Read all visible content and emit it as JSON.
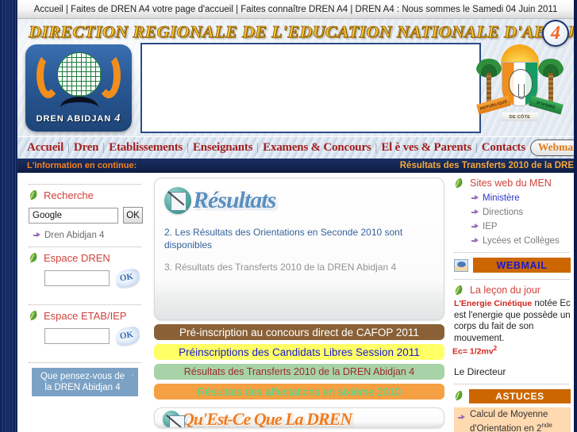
{
  "topbar": {
    "text": "Accueil | Faites de DREN A4 votre page d'accueil | Faites connaître DREN A4 | DREN A4 : Nous sommes le Samedi 04 Juin 2011"
  },
  "header": {
    "title": "DIRECTION REGIONALE DE L'EDUCATION NATIONALE D'ABIDJAN",
    "badge": "4",
    "logo_text": "DREN  ABIDJAN",
    "logo_number": "4",
    "coat_ribbon_left": "REPUBLIQUE",
    "coat_ribbon_right": "D'IVOIRE",
    "coat_ribbon_center": "DE CÔTE"
  },
  "nav": {
    "items": [
      "Accueil",
      "Dren",
      "Etablissements",
      "Enseignants",
      "Examens & Concours",
      "El è ves & Parents",
      "Contacts"
    ],
    "separator": "|",
    "webmail": "Webmail"
  },
  "ticker": {
    "label": "L'information en continue:",
    "text": "Résultats des Transferts 2010 de la DRE"
  },
  "sidebar_left": {
    "search": {
      "title": "Recherche",
      "value": "Google",
      "button": "OK",
      "link": "Dren Abidjan 4"
    },
    "espace_dren": {
      "title": "Espace DREN",
      "value": "",
      "button_label": "OK"
    },
    "espace_etab": {
      "title": "Espace ETAB/IEP",
      "value": "",
      "button_label": "OK"
    },
    "poll": {
      "text": "Que pensez-vous de la DREN Abidjan 4"
    }
  },
  "center": {
    "results_title": "Résultats",
    "results_items": [
      "2. Les Résultats des Orientations en Seconde 2010 sont disponibles",
      "3. Résultats des Transferts 2010 de la DREN Abidjan 4"
    ],
    "bars": [
      {
        "label": "Pré-inscription au concours direct de CAFOP 2011",
        "bg": "#8a6137",
        "fg": "#ffffff"
      },
      {
        "label": "Préinscriptions des Candidats Libres Session 2011",
        "bg": "#ffff66",
        "fg": "#1a1ad0"
      },
      {
        "label": "Résultats des Transferts 2010 de la DREN Abidjan 4",
        "bg": "#a8d3a8",
        "fg": "#9b2a2a"
      },
      {
        "label": "Résultats des affectations en sixième 2010",
        "bg": "#f5a042",
        "fg": "#3ddc97"
      }
    ],
    "bottom_panel_title": "Qu'Est-Ce Que La DREN"
  },
  "sidebar_right": {
    "sites_title": "Sites web du MEN",
    "sites_links": [
      "Ministère",
      "Directions",
      "IEP",
      "Lycées et Collèges"
    ],
    "webmail_label": "WEBMAIL",
    "lesson_title": "La leçon du jour",
    "lesson_em": "L'Energie Cinétique",
    "lesson_body": " notée Ec est l'energie que possède un corps du fait de son mouvement.",
    "lesson_formula_prefix": "Ec= 1/2mv",
    "lesson_formula_sup": "2",
    "director": "Le Directeur",
    "astuces_label": "ASTUCES",
    "astuce_items": [
      "Calcul de Moyenne d'Orientation en 2"
    ],
    "astuce_sup": "nde"
  }
}
